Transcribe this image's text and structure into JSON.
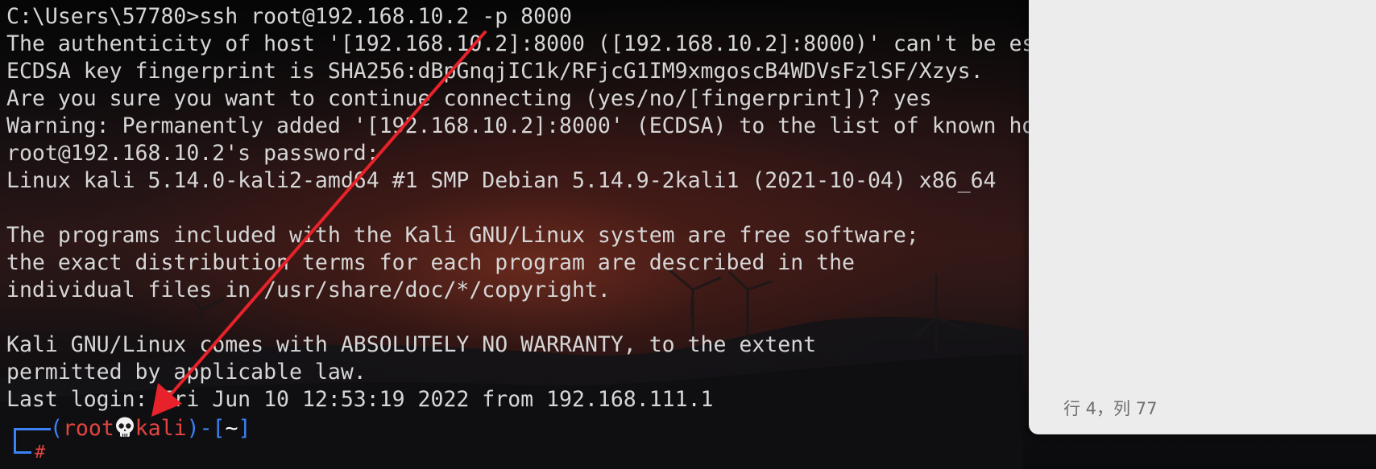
{
  "terminal": {
    "lines": [
      "C:\\Users\\57780>ssh root@192.168.10.2 -p 8000",
      "The authenticity of host '[192.168.10.2]:8000 ([192.168.10.2]:8000)' can't be established.",
      "ECDSA key fingerprint is SHA256:dBpGnqjIC1k/RFjcG1IM9xmgoscB4WDVsFzlSF/Xzys.",
      "Are you sure you want to continue connecting (yes/no/[fingerprint])? yes",
      "Warning: Permanently added '[192.168.10.2]:8000' (ECDSA) to the list of known hosts.",
      "root@192.168.10.2's password:",
      "Linux kali 5.14.0-kali2-amd64 #1 SMP Debian 5.14.9-2kali1 (2021-10-04) x86_64",
      "",
      "The programs included with the Kali GNU/Linux system are free software;",
      "the exact distribution terms for each program are described in the",
      "individual files in /usr/share/doc/*/copyright.",
      "",
      "Kali GNU/Linux comes with ABSOLUTELY NO WARRANTY, to the extent",
      "permitted by applicable law.",
      "Last login: Fri Jun 10 12:53:19 2022 from 192.168.111.1"
    ],
    "prompt": {
      "open_paren": "(",
      "user": "root",
      "host": "kali",
      "close_paren": ")-[",
      "path": "~",
      "close_bracket": "]",
      "symbol": "#"
    }
  },
  "side_panel": {
    "status": "行 4，列 77"
  },
  "colors": {
    "prompt_blue": "#3b82f6",
    "prompt_red": "#e2453f",
    "annotation_arrow": "#e8222a"
  },
  "icons": {
    "prompt_separator": "skull-icon",
    "annotation": "red-arrow"
  }
}
